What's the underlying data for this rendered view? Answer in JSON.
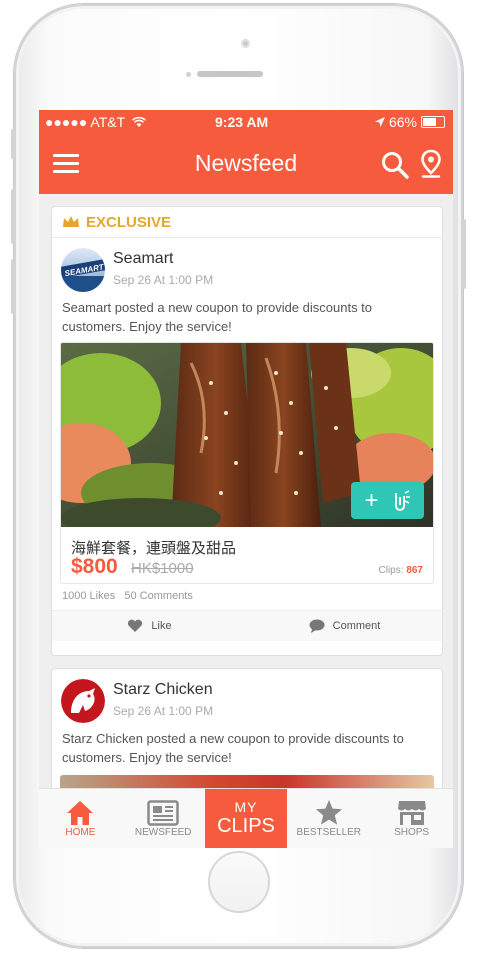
{
  "status_bar": {
    "carrier": "●●●●● AT&T",
    "time": "9:23 AM",
    "battery": "66%"
  },
  "app_bar": {
    "title": "Newsfeed"
  },
  "posts": [
    {
      "badge": "EXCLUSIVE",
      "author": "Seamart",
      "avatar_text": "SEAMART",
      "date": "Sep 26 At 1:00 PM",
      "text": "Seamart posted a new coupon to provide discounts to customers. Enjoy the service!",
      "coupon": {
        "name": "海鮮套餐，連頭盤及甜品",
        "price": "$800",
        "old_price": "HK$1000",
        "clips_label": "Clips:",
        "clips_count": "867"
      },
      "likes": "1000 Likes",
      "comments": "50 Comments",
      "like_label": "Like",
      "comment_label": "Comment"
    },
    {
      "author": "Starz Chicken",
      "date": "Sep 26 At 1:00 PM",
      "text": "Starz Chicken posted a new coupon to provide discounts to customers. Enjoy the service!"
    }
  ],
  "tabs": [
    {
      "label": "HOME",
      "icon": "home-icon"
    },
    {
      "label": "NEWSFEED",
      "icon": "newspaper-icon"
    },
    {
      "label_top": "MY",
      "label_bottom": "CLIPS"
    },
    {
      "label": "BESTSELLER",
      "icon": "star-icon"
    },
    {
      "label": "SHOPS",
      "icon": "shop-icon"
    }
  ],
  "colors": {
    "accent": "#f55b3c",
    "teal": "#2ec6b5",
    "gold": "#e6a62c"
  }
}
